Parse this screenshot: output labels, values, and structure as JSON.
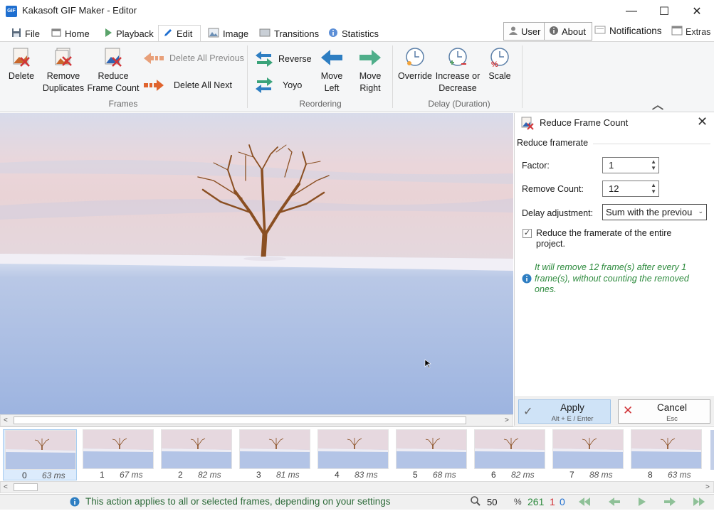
{
  "window": {
    "icon_text": "GIF",
    "title": "Kakasoft GIF Maker - Editor",
    "minimize_glyph": "—",
    "maximize_glyph": "☐",
    "close_glyph": "✕"
  },
  "tabs": [
    {
      "label": "File",
      "icon": "save-icon"
    },
    {
      "label": "Home",
      "icon": "home-icon"
    },
    {
      "label": "Playback",
      "icon": "play-icon"
    },
    {
      "label": "Edit",
      "icon": "pencil-icon",
      "active": true
    },
    {
      "label": "Image",
      "icon": "image-icon"
    },
    {
      "label": "Transitions",
      "icon": "transitions-icon"
    },
    {
      "label": "Statistics",
      "icon": "info-icon"
    }
  ],
  "header_buttons": {
    "user": "User",
    "about": "About",
    "notifications": "Notifications",
    "extras": "Extras"
  },
  "ribbon": {
    "frames": {
      "delete": "Delete",
      "remove_duplicates_1": "Remove",
      "remove_duplicates_2": "Duplicates",
      "reduce_1": "Reduce",
      "reduce_2": "Frame Count",
      "delete_all_previous": "Delete All Previous",
      "delete_all_next": "Delete All Next",
      "group": "Frames"
    },
    "reordering": {
      "reverse": "Reverse",
      "yoyo": "Yoyo",
      "move_left_1": "Move",
      "move_left_2": "Left",
      "move_right_1": "Move",
      "move_right_2": "Right",
      "group": "Reordering"
    },
    "delay": {
      "override": "Override",
      "incdec_1": "Increase or",
      "incdec_2": "Decrease",
      "scale": "Scale",
      "group": "Delay (Duration)"
    },
    "collapse_glyph": "︿"
  },
  "panel": {
    "title": "Reduce Frame Count",
    "section": "Reduce framerate",
    "factor_label": "Factor:",
    "factor_value": "1",
    "remove_label": "Remove Count:",
    "remove_value": "12",
    "delay_label": "Delay adjustment:",
    "delay_value": "Sum with the previous",
    "checkbox_line1": "Reduce the framerate of the entire",
    "checkbox_line2": "project.",
    "checkbox_checked": true,
    "info_line1": "It will remove 12 frame(s) after every 1",
    "info_line2": "frame(s), without counting the removed",
    "info_line3": "ones.",
    "apply_label": "Apply",
    "apply_shortcut": "Alt + E / Enter",
    "cancel_label": "Cancel",
    "cancel_shortcut": "Esc"
  },
  "frames": [
    {
      "index": "0",
      "ms": "63 ms"
    },
    {
      "index": "1",
      "ms": "67 ms"
    },
    {
      "index": "2",
      "ms": "82 ms"
    },
    {
      "index": "3",
      "ms": "81 ms"
    },
    {
      "index": "4",
      "ms": "83 ms"
    },
    {
      "index": "5",
      "ms": "68 ms"
    },
    {
      "index": "6",
      "ms": "82 ms"
    },
    {
      "index": "7",
      "ms": "88 ms"
    },
    {
      "index": "8",
      "ms": "63 ms"
    }
  ],
  "status": {
    "message": "This action applies to all or selected frames, depending on your settings",
    "zoom": "50",
    "zoom_unit": "%",
    "frame_count": "261",
    "selected_count": "1",
    "current_frame": "0"
  },
  "colors": {
    "accent": "#1f6fd0",
    "green_text": "#2e8b3e",
    "red_text": "#d13438"
  }
}
